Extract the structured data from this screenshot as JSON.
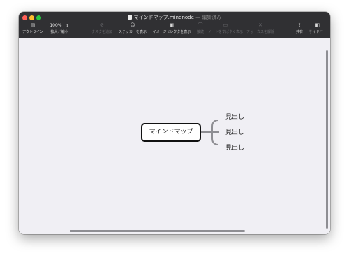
{
  "window": {
    "title": "マインドマップ.mindnode",
    "edited_suffix": "— 編集済み"
  },
  "toolbar": {
    "outline": {
      "label": "アウトライン",
      "icon": "sidebar-left-icon"
    },
    "zoom": {
      "value": "100%",
      "label": "拡大／縮小",
      "stepper": "⌃⌄"
    },
    "add_task": {
      "label": "タスクを追加",
      "icon": "checkmark-circle-icon"
    },
    "stickers": {
      "label": "ステッカーを表示",
      "icon": "smiley-icon"
    },
    "image_selector": {
      "label": "イメージセレクタを表示",
      "icon": "photo-icon"
    },
    "link": {
      "label": "接続",
      "icon": "link-icon"
    },
    "note": {
      "label": "ノートをすばやく表示",
      "icon": "note-icon"
    },
    "focus": {
      "label": "フォーカスを解除",
      "icon": "scissors-icon"
    },
    "share": {
      "label": "共有",
      "icon": "share-icon"
    },
    "sidebar": {
      "label": "サイドバー",
      "icon": "sidebar-right-icon"
    }
  },
  "mindmap": {
    "central_topic": "マインドマップ",
    "branches": [
      "見出し",
      "見出し",
      "見出し"
    ]
  }
}
